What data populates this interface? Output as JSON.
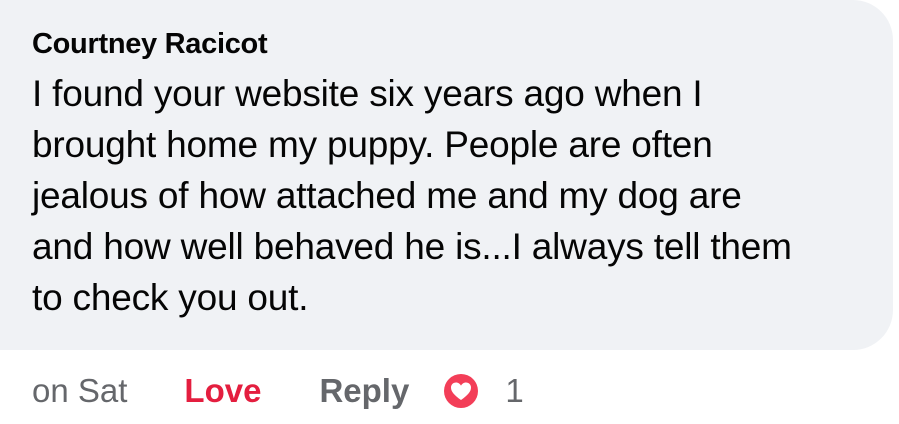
{
  "comment": {
    "author": "Courtney Racicot",
    "text": "I found your website six years ago when I\nbrought home my puppy.  People are often\njealous of how attached me and my dog are\nand how well behaved he is...I always tell them\nto check you out."
  },
  "actions": {
    "timestamp": "on Sat",
    "love_label": "Love",
    "reply_label": "Reply",
    "reaction_icon": "heart-icon",
    "reaction_count": "1"
  },
  "colors": {
    "bubble": "#f0f2f5",
    "love": "#e41e3f",
    "muted": "#65676b",
    "text": "#050505"
  }
}
